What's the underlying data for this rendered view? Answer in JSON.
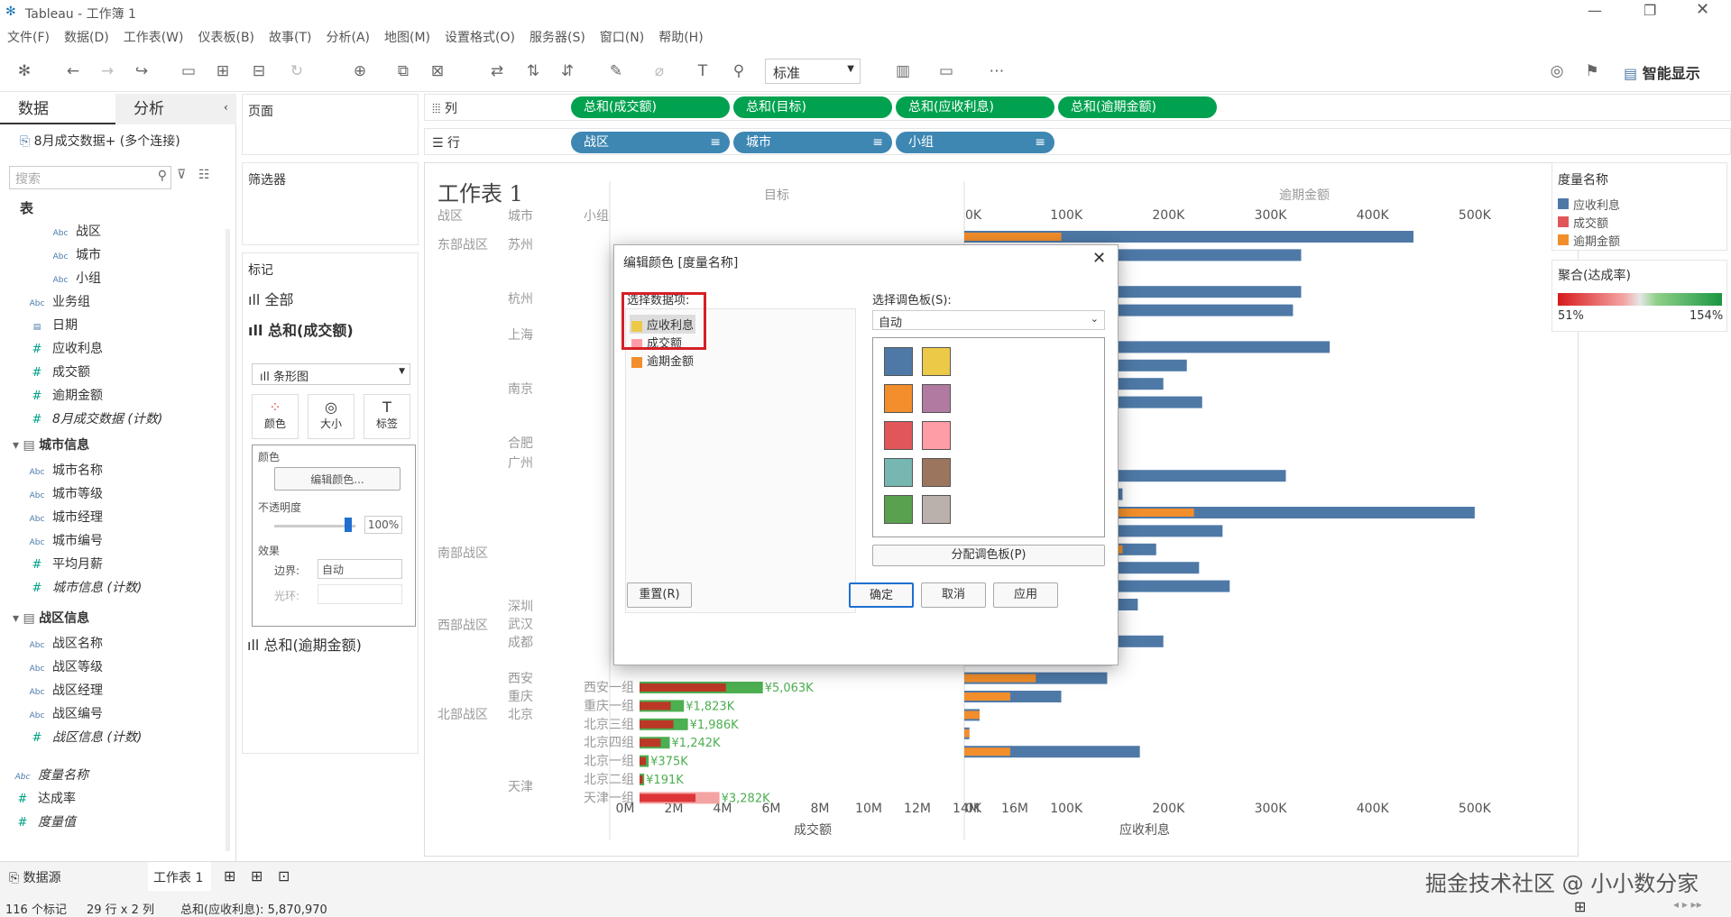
{
  "window": {
    "title": "Tableau - 工作簿 1"
  },
  "menu": [
    "文件(F)",
    "数据(D)",
    "工作表(W)",
    "仪表板(B)",
    "故事(T)",
    "分析(A)",
    "地图(M)",
    "设置格式(O)",
    "服务器(S)",
    "窗口(N)",
    "帮助(H)"
  ],
  "toolbar": {
    "fit": "标准",
    "smart": "智能显示"
  },
  "side": {
    "tab_data": "数据",
    "tab_analysis": "分析",
    "source": "8月成交数据+ (多个连接)",
    "search_placeholder": "搜索",
    "table": "表",
    "fields": [
      {
        "n": "战区",
        "t": "dim"
      },
      {
        "n": "城市",
        "t": "dim"
      },
      {
        "n": "小组",
        "t": "dim"
      },
      {
        "n": "业务组",
        "t": "dim0"
      },
      {
        "n": "日期",
        "t": "date"
      },
      {
        "n": "应收利息",
        "t": "mea"
      },
      {
        "n": "成交额",
        "t": "mea"
      },
      {
        "n": "逾期金额",
        "t": "mea"
      },
      {
        "n": "8月成交数据 (计数)",
        "t": "meai"
      }
    ],
    "group1": "城市信息",
    "group1_fields": [
      "城市名称",
      "城市等级",
      "城市经理",
      "城市编号"
    ],
    "g1_measure": "平均月薪",
    "g1_count": "城市信息 (计数)",
    "group2": "战区信息",
    "group2_fields": [
      "战区名称",
      "战区等级",
      "战区经理",
      "战区编号"
    ],
    "g2_count": "战区信息 (计数)",
    "measure_names": "度量名称",
    "rate": "达成率",
    "measure_values": "度量值"
  },
  "cards": {
    "pages": "页面",
    "filters": "筛选器",
    "marks": "标记",
    "all": "全部",
    "sum_deal": "总和(成交额)",
    "mark_type": "条形图",
    "color": "颜色",
    "size": "大小",
    "label": "标签",
    "color_pop": {
      "title": "颜色",
      "edit_btn": "编辑颜色...",
      "opacity": "不透明度",
      "opacity_val": "100%",
      "effects": "效果",
      "border": "边界:",
      "border_val": "自动",
      "halo": "光环:"
    },
    "sum_overdue": "总和(逾期金额)"
  },
  "shelves": {
    "cols_label": "列",
    "rows_label": "行",
    "cols": [
      "总和(成交额)",
      "总和(目标)",
      "总和(应收利息)",
      "总和(逾期金额)"
    ],
    "rows": [
      "战区",
      "城市",
      "小组"
    ]
  },
  "view": {
    "title": "工作表 1",
    "hdr": [
      "战区",
      "城市",
      "小组"
    ],
    "col_target": "目标",
    "col_overdue": "逾期金额",
    "x1": "成交额",
    "x2": "应收利息",
    "regions": [
      "东部战区",
      "南部战区",
      "西部战区",
      "北部战区"
    ],
    "cities": [
      "苏州",
      "杭州",
      "上海",
      "南京",
      "合肥",
      "广州",
      "深圳",
      "武汉",
      "成都",
      "西安",
      "重庆",
      "北京",
      "天津"
    ],
    "ticks_deal": [
      "0M",
      "2M",
      "4M",
      "6M",
      "8M",
      "10M",
      "12M",
      "14M",
      "16M"
    ],
    "ticks_int": [
      "0K",
      "100K",
      "200K",
      "300K",
      "400K",
      "500K"
    ],
    "bottom_rows": [
      {
        "g": "西安一组",
        "c": "西安",
        "v": "¥5,063K"
      },
      {
        "g": "重庆一组",
        "c": "重庆",
        "v": "¥1,823K"
      },
      {
        "g": "北京三组",
        "c": "北京",
        "v": "¥1,986K"
      },
      {
        "g": "北京四组",
        "c": "",
        "v": "¥1,242K"
      },
      {
        "g": "北京一组",
        "c": "",
        "v": "¥375K"
      },
      {
        "g": "北京二组",
        "c": "",
        "v": "¥191K"
      },
      {
        "g": "天津一组",
        "c": "天津",
        "v": "¥3,282K"
      }
    ]
  },
  "legend": {
    "title": "度量名称",
    "items": [
      "应收利息",
      "成交额",
      "逾期金额"
    ],
    "colors": [
      "#4e79a7",
      "#e15759",
      "#f28e2b"
    ],
    "grad_title": "聚合(达成率)",
    "min": "51%",
    "max": "154%"
  },
  "dialog": {
    "title": "编辑颜色 [度量名称]",
    "select_item": "选择数据项:",
    "items": [
      "应收利息",
      "成交额",
      "逾期金额"
    ],
    "item_colors": [
      "#edc948",
      "#ff9da7",
      "#f28e2b"
    ],
    "select_palette": "选择调色板(S):",
    "palette": "自动",
    "swatches": [
      "#4e79a7",
      "#edc948",
      "#f28e2b",
      "#b07aa1",
      "#e15759",
      "#ff9da7",
      "#76b7b2",
      "#9c755f",
      "#59a14f",
      "#bab0ac"
    ],
    "assign": "分配调色板(P)",
    "reset": "重置(R)",
    "ok": "确定",
    "cancel": "取消",
    "apply": "应用"
  },
  "status": {
    "datasource": "数据源",
    "sheet": "工作表 1",
    "marks": "116 个标记",
    "rowscols": "29 行 x 2 列",
    "sum": "总和(应收利息): 5,870,970"
  },
  "watermark": "掘金技术社区 @ 小小数分家",
  "chart_data": {
    "type": "bar",
    "title": "工作表 1",
    "interest_bars": [
      {
        "o": 95,
        "i": 440
      },
      {
        "o": 20,
        "i": 330
      },
      {
        "o": 5,
        "i": 5
      },
      {
        "o": 40,
        "i": 330
      },
      {
        "o": 65,
        "i": 322
      },
      {
        "o": 35,
        "i": 115
      },
      {
        "o": 30,
        "i": 358
      },
      {
        "o": 20,
        "i": 218
      },
      {
        "o": 25,
        "i": 195
      },
      {
        "o": 5,
        "i": 233
      },
      {
        "o": 35,
        "i": 145
      },
      {
        "o": 40,
        "i": 147
      },
      {
        "o": 15,
        "i": 98
      },
      {
        "o": 145,
        "i": 315
      },
      {
        "o": 130,
        "i": 155
      },
      {
        "o": 225,
        "i": 500
      },
      {
        "o": 45,
        "i": 253
      },
      {
        "o": 155,
        "i": 188
      },
      {
        "o": 5,
        "i": 230
      },
      {
        "o": 5,
        "i": 260
      },
      {
        "o": 5,
        "i": 170
      },
      {
        "o": 5,
        "i": 5
      },
      {
        "o": 125,
        "i": 195
      },
      {
        "o": 40,
        "i": 145
      },
      {
        "o": 70,
        "i": 140
      },
      {
        "o": 45,
        "i": 95
      },
      {
        "o": 15,
        "i": 15
      },
      {
        "o": 5,
        "i": 5
      },
      {
        "o": 45,
        "i": 172
      }
    ],
    "xlabel": "应收利息",
    "xlim": [
      0,
      500
    ]
  }
}
